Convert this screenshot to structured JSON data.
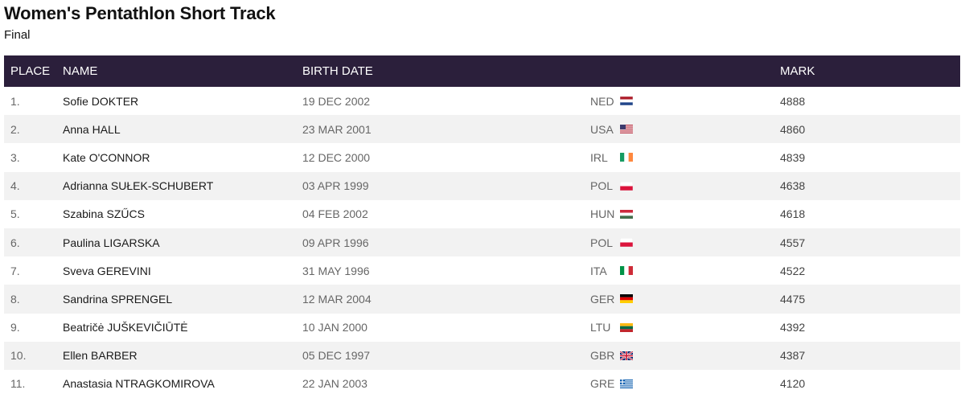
{
  "event": {
    "title": "Women's Pentathlon Short Track",
    "round": "Final"
  },
  "table": {
    "headers": {
      "place": "PLACE",
      "name": "NAME",
      "birth_date": "BIRTH DATE",
      "country": "",
      "mark": "MARK"
    },
    "rows": [
      {
        "place": "1.",
        "name": "Sofie DOKTER",
        "birth_date": "19 DEC 2002",
        "country": "NED",
        "flag": "flag-ned-icon",
        "mark": "4888"
      },
      {
        "place": "2.",
        "name": "Anna HALL",
        "birth_date": "23 MAR 2001",
        "country": "USA",
        "flag": "flag-usa-icon",
        "mark": "4860"
      },
      {
        "place": "3.",
        "name": "Kate O'CONNOR",
        "birth_date": "12 DEC 2000",
        "country": "IRL",
        "flag": "flag-irl-icon",
        "mark": "4839"
      },
      {
        "place": "4.",
        "name": "Adrianna SUŁEK-SCHUBERT",
        "birth_date": "03 APR 1999",
        "country": "POL",
        "flag": "flag-pol-icon",
        "mark": "4638"
      },
      {
        "place": "5.",
        "name": "Szabina SZŰCS",
        "birth_date": "04 FEB 2002",
        "country": "HUN",
        "flag": "flag-hun-icon",
        "mark": "4618"
      },
      {
        "place": "6.",
        "name": "Paulina LIGARSKA",
        "birth_date": "09 APR 1996",
        "country": "POL",
        "flag": "flag-pol-icon",
        "mark": "4557"
      },
      {
        "place": "7.",
        "name": "Sveva GEREVINI",
        "birth_date": "31 MAY 1996",
        "country": "ITA",
        "flag": "flag-ita-icon",
        "mark": "4522"
      },
      {
        "place": "8.",
        "name": "Sandrina SPRENGEL",
        "birth_date": "12 MAR 2004",
        "country": "GER",
        "flag": "flag-ger-icon",
        "mark": "4475"
      },
      {
        "place": "9.",
        "name": "Beatričė JUŠKEVIČIŪTĖ",
        "birth_date": "10 JAN 2000",
        "country": "LTU",
        "flag": "flag-ltu-icon",
        "mark": "4392"
      },
      {
        "place": "10.",
        "name": "Ellen BARBER",
        "birth_date": "05 DEC 1997",
        "country": "GBR",
        "flag": "flag-gbr-icon",
        "mark": "4387"
      },
      {
        "place": "11.",
        "name": "Anastasia NTRAGKOMIROVA",
        "birth_date": "22 JAN 2003",
        "country": "GRE",
        "flag": "flag-gre-icon",
        "mark": "4120"
      }
    ]
  },
  "colors": {
    "header_bg": "#2b1f3b",
    "zebra_bg": "#f2f2f2"
  }
}
